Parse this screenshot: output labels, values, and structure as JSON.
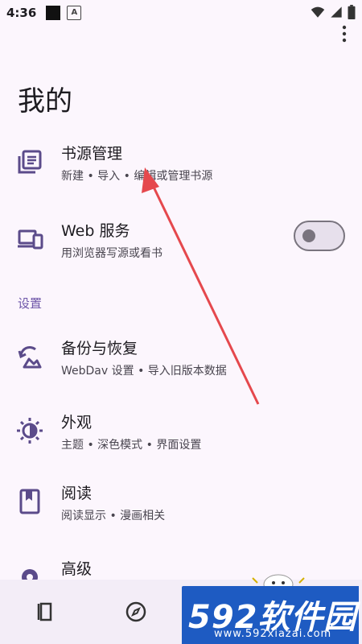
{
  "status_bar": {
    "time": "4:36",
    "a_badge": "A"
  },
  "page": {
    "title": "我的"
  },
  "items": [
    {
      "title": "书源管理",
      "subtitle": "新建 • 导入 • 编辑或管理书源",
      "icon": "book-source-icon"
    },
    {
      "title": "Web 服务",
      "subtitle": "用浏览器写源或看书",
      "icon": "devices-icon",
      "toggle_on": false
    }
  ],
  "settings_section": {
    "label": "设置"
  },
  "settings_items": [
    {
      "title": "备份与恢复",
      "subtitle": "WebDav 设置 • 导入旧版本数据",
      "icon": "backup-restore-icon"
    },
    {
      "title": "外观",
      "subtitle": "主题 • 深色模式 • 界面设置",
      "icon": "theme-icon"
    },
    {
      "title": "阅读",
      "subtitle": "阅读显示 • 漫画相关",
      "icon": "bookmark-book-icon"
    },
    {
      "title": "高级",
      "subtitle": "",
      "icon": "gear-icon"
    }
  ],
  "watermark": {
    "brand_num": "592",
    "brand_text": "软件园",
    "url": "www.592xiazai.com"
  },
  "colors": {
    "accent": "#5b4b8a",
    "background": "#fcf6fd",
    "arrow": "#e5484d",
    "watermark_bg": "#1e5bc2"
  }
}
